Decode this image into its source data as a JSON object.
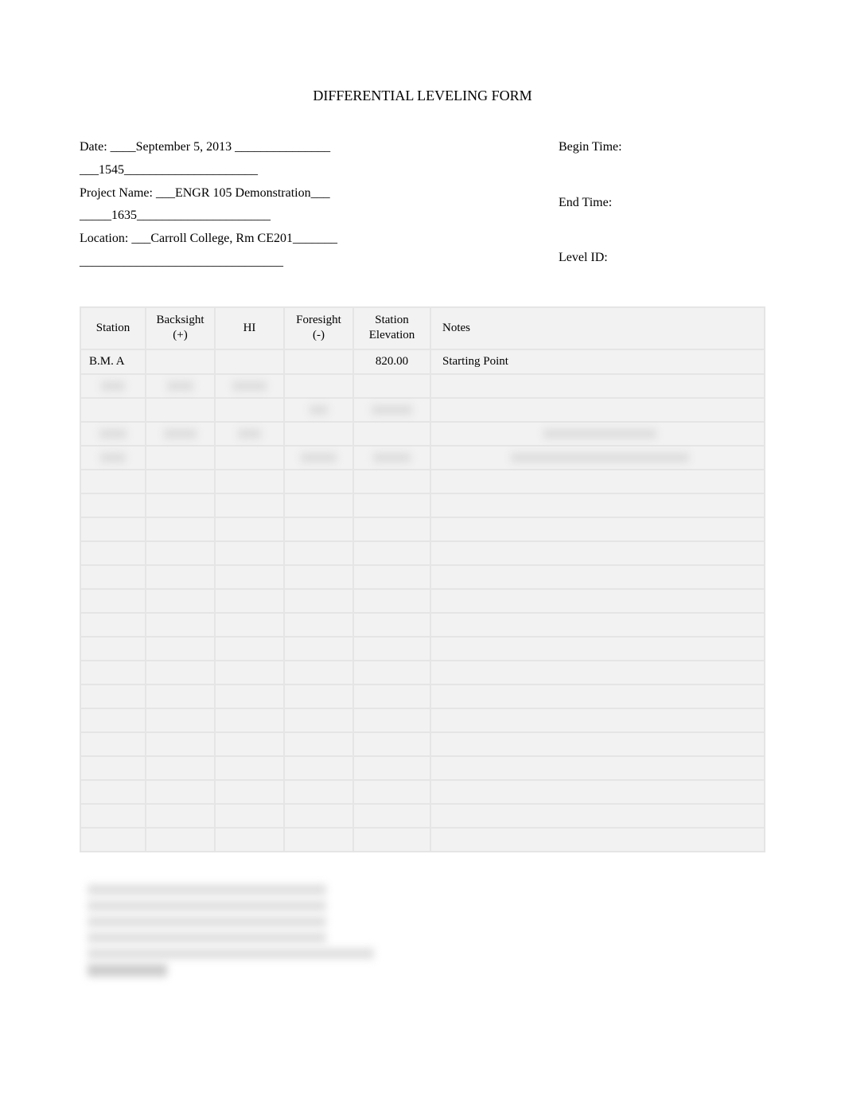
{
  "title": "DIFFERENTIAL LEVELING FORM",
  "header": {
    "date_label": "Date: ____",
    "date_value": "September 5, 2013",
    "date_trail": " _______________",
    "line2": "___1545_____________________",
    "project_label": "Project Name: ___",
    "project_value": "ENGR 105 Demonstration",
    "project_trail": "___",
    "line4": "_____1635_____________________",
    "location_label": "Location: ___",
    "location_value": "Carroll College, Rm CE201",
    "location_trail": "_______",
    "line6": "________________________________",
    "begin_time_label": "Begin Time:",
    "end_time_label": "End Time:",
    "level_id_label": "Level ID:"
  },
  "table": {
    "headers": {
      "station": "Station",
      "backsight": "Backsight\n(+)",
      "hi": "HI",
      "foresight": "Foresight\n(-)",
      "elevation": "Station\nElevation",
      "notes": "Notes"
    },
    "rows": [
      {
        "station": "B.M. A",
        "backsight": "",
        "hi": "",
        "foresight": "",
        "elevation": "820.00",
        "notes": "Starting Point",
        "blurred": false
      },
      {
        "station": "",
        "backsight": "",
        "hi": "",
        "foresight": "",
        "elevation": "",
        "notes": "",
        "blurred": true
      },
      {
        "station": "",
        "backsight": "",
        "hi": "",
        "foresight": "",
        "elevation": "",
        "notes": "",
        "blurred": true
      },
      {
        "station": "",
        "backsight": "",
        "hi": "",
        "foresight": "",
        "elevation": "",
        "notes": "",
        "blurred": true
      },
      {
        "station": "",
        "backsight": "",
        "hi": "",
        "foresight": "",
        "elevation": "",
        "notes": "",
        "blurred": true
      },
      {
        "station": "",
        "backsight": "",
        "hi": "",
        "foresight": "",
        "elevation": "",
        "notes": "",
        "blurred": true
      },
      {
        "station": "",
        "backsight": "",
        "hi": "",
        "foresight": "",
        "elevation": "",
        "notes": "",
        "blurred": true
      },
      {
        "station": "",
        "backsight": "",
        "hi": "",
        "foresight": "",
        "elevation": "",
        "notes": "",
        "blurred": true
      },
      {
        "station": "",
        "backsight": "",
        "hi": "",
        "foresight": "",
        "elevation": "",
        "notes": "",
        "blurred": true
      },
      {
        "station": "",
        "backsight": "",
        "hi": "",
        "foresight": "",
        "elevation": "",
        "notes": "",
        "blurred": true
      },
      {
        "station": "",
        "backsight": "",
        "hi": "",
        "foresight": "",
        "elevation": "",
        "notes": "",
        "blurred": true
      },
      {
        "station": "",
        "backsight": "",
        "hi": "",
        "foresight": "",
        "elevation": "",
        "notes": "",
        "blurred": true
      },
      {
        "station": "",
        "backsight": "",
        "hi": "",
        "foresight": "",
        "elevation": "",
        "notes": "",
        "blurred": true
      },
      {
        "station": "",
        "backsight": "",
        "hi": "",
        "foresight": "",
        "elevation": "",
        "notes": "",
        "blurred": true
      },
      {
        "station": "",
        "backsight": "",
        "hi": "",
        "foresight": "",
        "elevation": "",
        "notes": "",
        "blurred": true
      },
      {
        "station": "",
        "backsight": "",
        "hi": "",
        "foresight": "",
        "elevation": "",
        "notes": "",
        "blurred": true
      },
      {
        "station": "",
        "backsight": "",
        "hi": "",
        "foresight": "",
        "elevation": "",
        "notes": "",
        "blurred": true
      },
      {
        "station": "",
        "backsight": "",
        "hi": "",
        "foresight": "",
        "elevation": "",
        "notes": "",
        "blurred": true
      },
      {
        "station": "",
        "backsight": "",
        "hi": "",
        "foresight": "",
        "elevation": "",
        "notes": "",
        "blurred": true
      },
      {
        "station": "",
        "backsight": "",
        "hi": "",
        "foresight": "",
        "elevation": "",
        "notes": "",
        "blurred": true
      },
      {
        "station": "",
        "backsight": "",
        "hi": "",
        "foresight": "",
        "elevation": "",
        "notes": "",
        "blurred": true
      }
    ]
  }
}
